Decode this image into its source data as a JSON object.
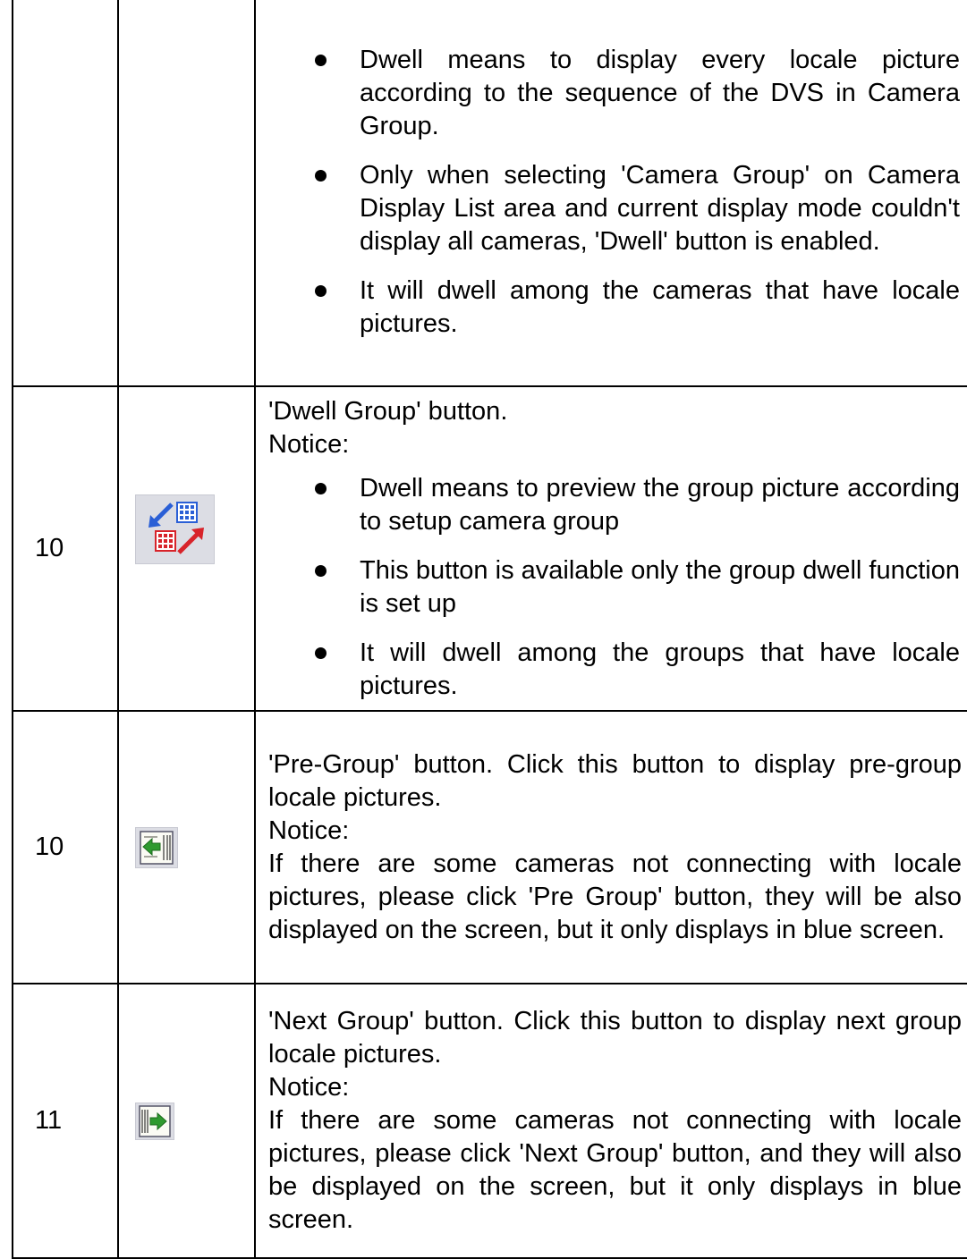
{
  "rows": [
    {
      "number": "",
      "icon": "",
      "text_lines": [],
      "bullets": [
        "Dwell means to display every locale picture according to the sequence of the DVS in Camera Group.",
        "Only when selecting 'Camera Group' on Camera Display List area and current display mode couldn't display all cameras, 'Dwell' button is enabled.",
        "It will dwell among the cameras that have locale pictures."
      ]
    },
    {
      "number": "10",
      "icon": "dwell-group-icon",
      "text_lines": [
        "'Dwell Group' button.",
        "Notice:"
      ],
      "bullets": [
        "Dwell means to preview the group picture according to setup camera group",
        "This button is available only the group dwell function is set up",
        "It will dwell among the groups that have locale pictures."
      ]
    },
    {
      "number": "10",
      "icon": "pre-group-icon",
      "text_lines": [
        "'Pre-Group' button. Click this button to display pre-group locale pictures.",
        "Notice:",
        "If there are some cameras not connecting with locale pictures, please click 'Pre Group' button, they will be also displayed on the screen, but it only displays in blue screen."
      ],
      "bullets": []
    },
    {
      "number": "11",
      "icon": "next-group-icon",
      "text_lines": [
        "'Next Group' button. Click this button to display next group locale pictures.",
        "Notice:",
        "If there are some cameras not connecting with locale pictures, please click 'Next Group' button, and they will also be displayed on the screen, but it only displays in blue screen."
      ],
      "bullets": []
    }
  ]
}
